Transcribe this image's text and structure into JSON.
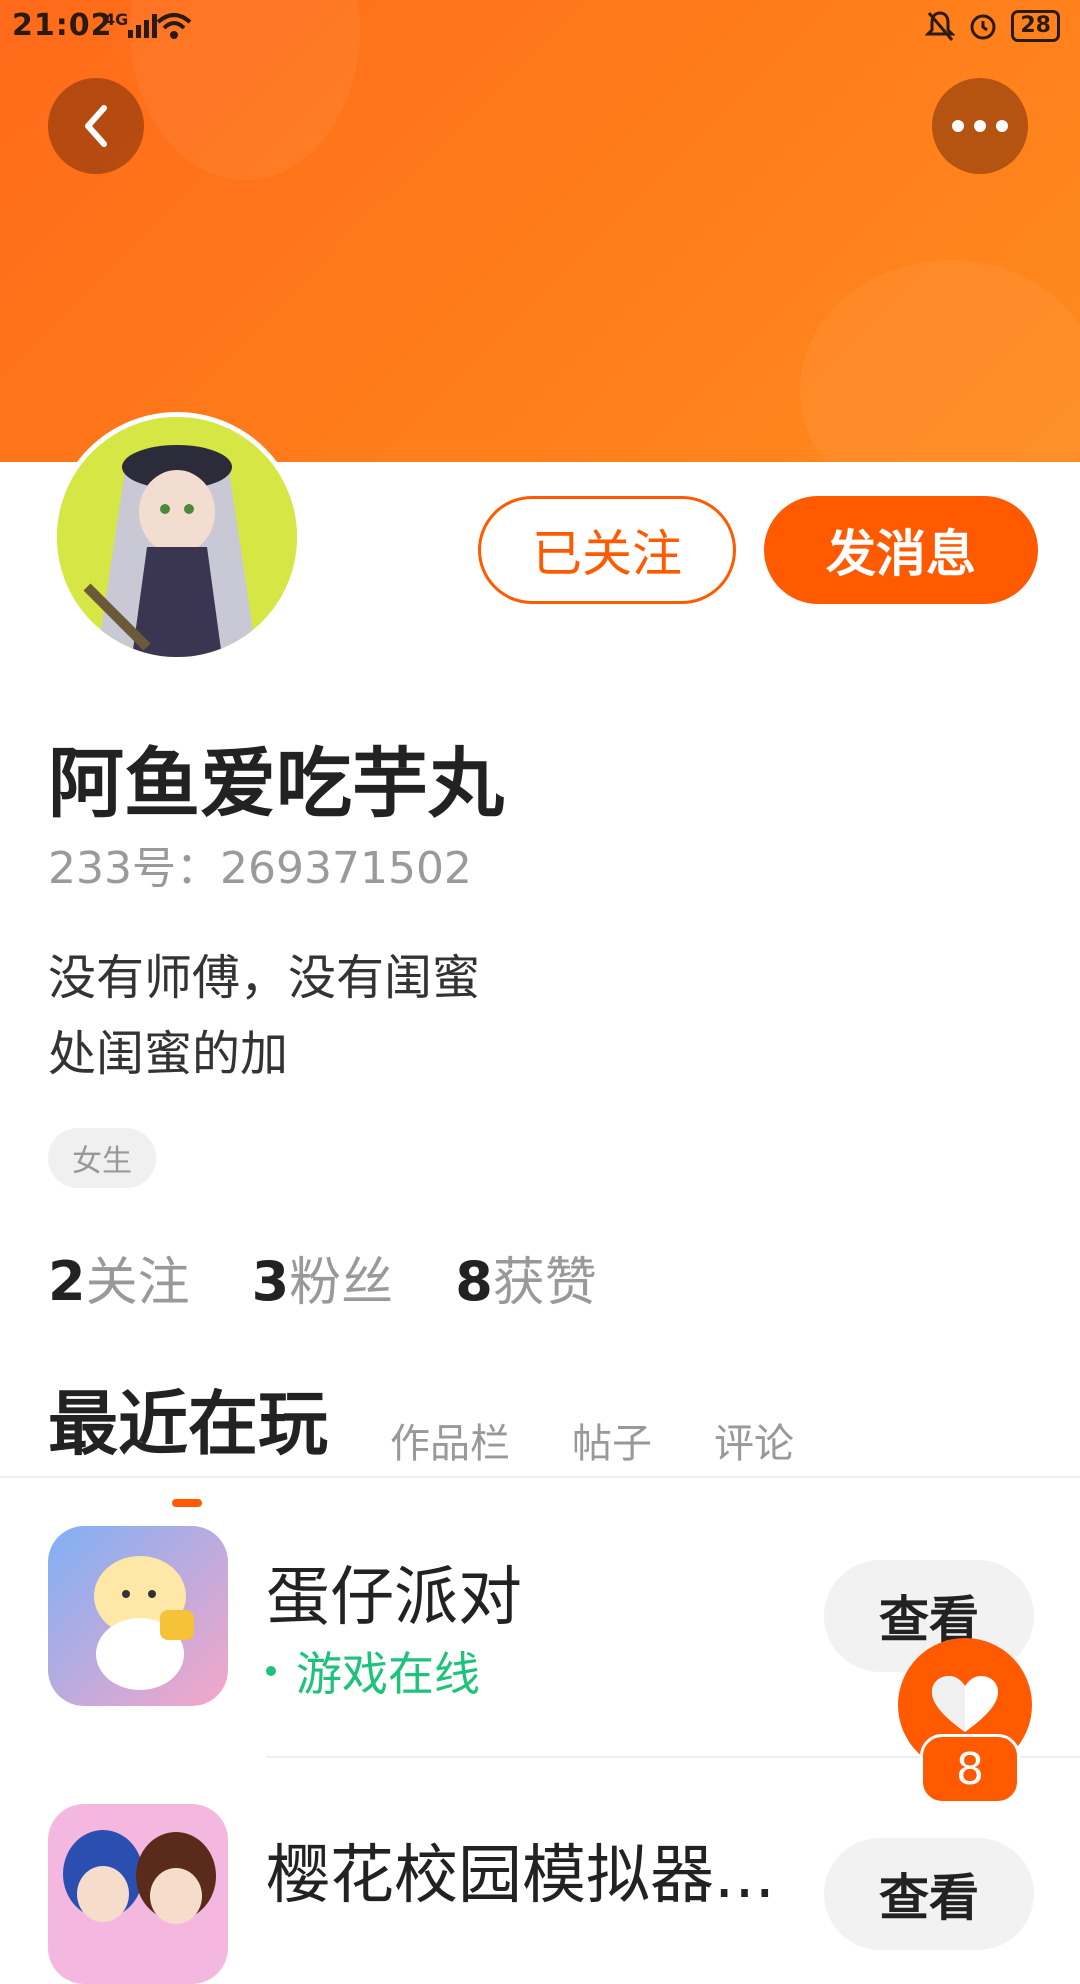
{
  "status_bar": {
    "time": "21:02",
    "network": "4G",
    "battery": "28"
  },
  "header": {
    "back": "back",
    "more": "more"
  },
  "actions": {
    "follow_label": "已关注",
    "message_label": "发消息"
  },
  "profile": {
    "username": "阿鱼爱吃芋丸",
    "uid": "233号：269371502",
    "bio_line1": "没有师傅，没有闺蜜",
    "bio_line2": "处闺蜜的加",
    "gender_tag": "女生"
  },
  "stats": [
    {
      "num": "2",
      "label": "关注"
    },
    {
      "num": "3",
      "label": "粉丝"
    },
    {
      "num": "8",
      "label": "获赞"
    }
  ],
  "tabs": [
    "最近在玩",
    "作品栏",
    "帖子",
    "评论"
  ],
  "games": [
    {
      "title": "蛋仔派对",
      "status": "游戏在线",
      "action": "查看"
    },
    {
      "title": "樱花校园模拟器...",
      "action": "查看"
    }
  ],
  "fab": {
    "count": "8"
  },
  "colors": {
    "accent": "#ff5a00",
    "banner": "#ff7a1a",
    "online": "#1fc27a"
  }
}
